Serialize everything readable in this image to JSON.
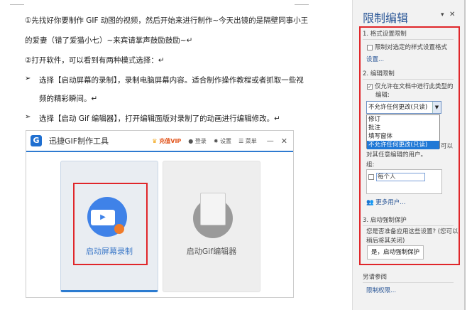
{
  "document": {
    "lines": [
      "①先找好你要制作 GIF 动图的视频，然后开始来进行制作~今天出镜的是隔壁同事小王",
      "的爱妻（错了爱猫小七）~来宾请掌声鼓励鼓励~↵",
      "②打开软件，可以看到有两种模式选择：↵"
    ],
    "bullets": [
      {
        "marker": "➢",
        "text": "选择【启动屏幕的录制】，录制电脑屏幕内容。适合制作操作教程或者抓取一些视",
        "cont": "频的精彩瞬间。↵"
      },
      {
        "marker": "➢",
        "text": "选择【启动 Gif 编辑器】，打开编辑面版对录制了的动画进行编辑修改。↵"
      }
    ]
  },
  "app": {
    "logo": "G",
    "title": "迅捷GIF制作工具",
    "vip": "充值VIP",
    "login": "登录",
    "settings": "设置",
    "menu": "菜单",
    "minimize": "—",
    "close": "✕",
    "cards": [
      {
        "label": "启动屏幕录制"
      },
      {
        "label": "启动Gif编辑器"
      }
    ]
  },
  "pane": {
    "title": "限制编辑",
    "pin": "▾",
    "close": "✕",
    "s1": {
      "heading": "1. 格式设置限制",
      "checkbox": "限制对选定的样式设置格式",
      "link": "设置..."
    },
    "s2": {
      "heading": "2. 编辑限制",
      "checkbox": "仅允许在文档中进行此类型的",
      "checkbox2": "编辑:",
      "selected": "不允许任何更改(只读)",
      "options": [
        "修订",
        "批注",
        "填写窗体",
        "不允许任何更改(只读)"
      ],
      "behind": "可以",
      "exceptions": "对其任意编辑的用户。",
      "group_label": "组:",
      "group_item": "每个人",
      "more_users": "更多用户..."
    },
    "s3": {
      "heading": "3. 启动强制保护",
      "question": "您是否准备应用这些设置? (您可以",
      "question2": "稍后将其关闭)",
      "button": "是，启动强制保护"
    },
    "see_also": {
      "heading": "另请参阅",
      "link": "限制权限..."
    }
  }
}
